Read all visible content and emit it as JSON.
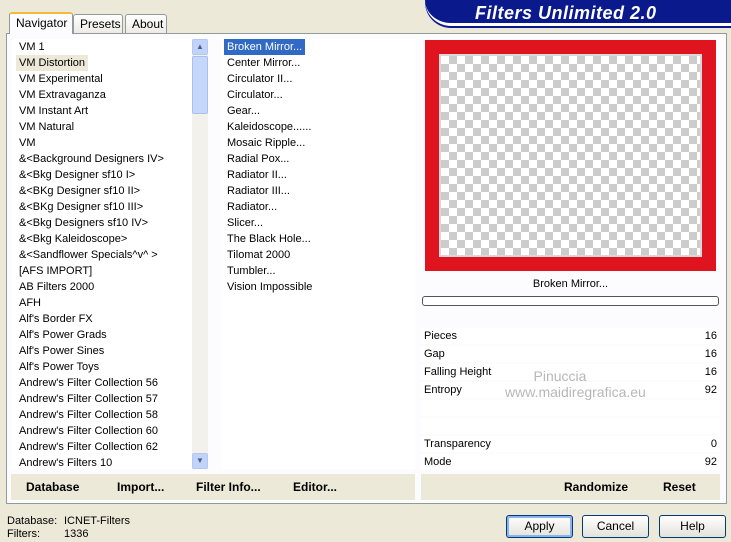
{
  "header": {
    "title": "Filters Unlimited 2.0"
  },
  "tabs": [
    {
      "label": "Navigator"
    },
    {
      "label": "Presets"
    },
    {
      "label": "About"
    }
  ],
  "categories": [
    "VM 1",
    "VM Distortion",
    "VM Experimental",
    "VM Extravaganza",
    "VM Instant Art",
    "VM Natural",
    "VM",
    "&<Background Designers IV>",
    "&<Bkg Designer sf10 I>",
    "&<BKg Designer sf10 II>",
    "&<BKg Designer sf10 III>",
    "&<Bkg Designers sf10 IV>",
    "&<Bkg Kaleidoscope>",
    "&<Sandflower Specials^v^ >",
    "[AFS IMPORT]",
    "AB Filters 2000",
    "AFH",
    "Alf's Border FX",
    "Alf's Power Grads",
    "Alf's Power Sines",
    "Alf's Power Toys",
    "Andrew's Filter Collection 56",
    "Andrew's Filter Collection 57",
    "Andrew's Filter Collection 58",
    "Andrew's Filter Collection 60",
    "Andrew's Filter Collection 62",
    "Andrew's Filters 10"
  ],
  "selected_category": "VM Distortion",
  "filters": [
    "Broken Mirror...",
    "Center Mirror...",
    "Circulator II...",
    "Circulator...",
    "Gear...",
    "Kaleidoscope......",
    "Mosaic Ripple...",
    "Radial Pox...",
    "Radiator II...",
    "Radiator III...",
    "Radiator...",
    "Slicer...",
    "The Black Hole...",
    "Tilomat 2000",
    "Tumbler...",
    "Vision Impossible"
  ],
  "selected_filter": "Broken Mirror...",
  "preview": {
    "label": "Broken Mirror...",
    "progress": 0
  },
  "params": [
    {
      "name": "Pieces",
      "value": "16"
    },
    {
      "name": "Gap",
      "value": "16"
    },
    {
      "name": "Falling Height",
      "value": "16"
    },
    {
      "name": "Entropy",
      "value": "92"
    },
    {
      "name": "",
      "value": ""
    },
    {
      "name": "",
      "value": ""
    },
    {
      "name": "Transparency",
      "value": "0"
    },
    {
      "name": "Mode",
      "value": "92"
    }
  ],
  "watermark": {
    "line1": "Pinuccia",
    "line2": "www.maidiregrafica.eu"
  },
  "toolbar": {
    "database": "Database",
    "import": "Import...",
    "filter_info": "Filter Info...",
    "editor": "Editor...",
    "randomize": "Randomize",
    "reset": "Reset"
  },
  "status": {
    "database_label": "Database:",
    "database_value": "ICNET-Filters",
    "filters_label": "Filters:",
    "filters_value": "1336"
  },
  "buttons": {
    "apply": "Apply",
    "cancel": "Cancel",
    "help": "Help"
  },
  "colors": {
    "selection": "#316ac5",
    "frame_red": "#e0141e",
    "title_bg": "#0a1a8c"
  }
}
